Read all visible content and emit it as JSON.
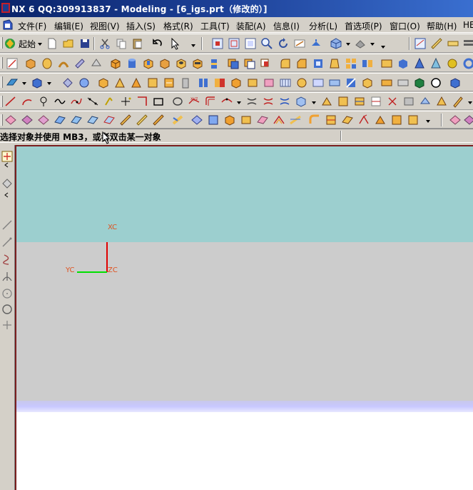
{
  "titlebar": {
    "title": "NX 6  QQ:309913837 - Modeling - [6_igs.prt（修改的）]"
  },
  "menubar": {
    "items": [
      {
        "id": "file",
        "label": "文件(F)"
      },
      {
        "id": "edit",
        "label": "编辑(E)"
      },
      {
        "id": "view",
        "label": "视图(V)"
      },
      {
        "id": "insert",
        "label": "插入(S)"
      },
      {
        "id": "format",
        "label": "格式(R)"
      },
      {
        "id": "tools",
        "label": "工具(T)"
      },
      {
        "id": "assembly",
        "label": "装配(A)"
      },
      {
        "id": "info",
        "label": "信息(I)"
      },
      {
        "id": "analysis",
        "label": "分析(L)"
      },
      {
        "id": "preferences",
        "label": "首选项(P)"
      },
      {
        "id": "window",
        "label": "窗口(O)"
      },
      {
        "id": "help",
        "label": "帮助(H)"
      },
      {
        "id": "hd",
        "label": "HE"
      }
    ]
  },
  "toolbar1": {
    "start_label": "起始"
  },
  "cueline": {
    "text": "选择对象并使用 MB3，或者双击某一对象"
  },
  "viewport": {
    "wcs": {
      "x_label": "XC",
      "y_label": "YC",
      "z_label": "ZC"
    },
    "colors": {
      "top": "#9ccfcf",
      "middle": "#cccccc",
      "x_axis": "#e00000",
      "y_axis": "#00e000"
    }
  }
}
